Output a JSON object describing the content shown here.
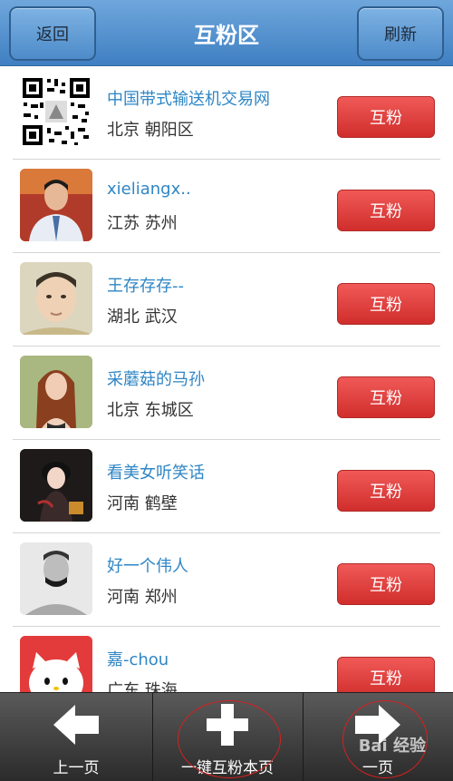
{
  "header": {
    "title": "互粉区",
    "back_label": "返回",
    "refresh_label": "刷新"
  },
  "follow_label": "互粉",
  "users": [
    {
      "name": "中国带式输送机交易网",
      "location": "北京 朝阳区",
      "avatar": "qr-code-avatar"
    },
    {
      "name": "xieliangx..",
      "location": "江苏 苏州",
      "avatar": "man-suit-avatar"
    },
    {
      "name": "王存存存--",
      "location": "湖北 武汉",
      "avatar": "young-man-avatar"
    },
    {
      "name": "采蘑菇的马孙",
      "location": "北京 东城区",
      "avatar": "woman-avatar"
    },
    {
      "name": "看美女听笑话",
      "location": "河南 鹤壁",
      "avatar": "doll-avatar"
    },
    {
      "name": "好一个伟人",
      "location": "河南 郑州",
      "avatar": "bw-man-avatar"
    },
    {
      "name": "嘉-chou",
      "location": "广东 珠海",
      "avatar": "hello-kitty-avatar"
    }
  ],
  "bottom": {
    "prev_label": "上一页",
    "follow_all_label": "一键互粉本页",
    "next_label": "一页"
  },
  "watermark": "Bai 经验",
  "colors": {
    "header_blue": "#4d8bc9",
    "link_blue": "#2f86c5",
    "button_red": "#d02e2c",
    "bar_dark": "#2b2b2b",
    "annotation_red": "#d82020"
  }
}
